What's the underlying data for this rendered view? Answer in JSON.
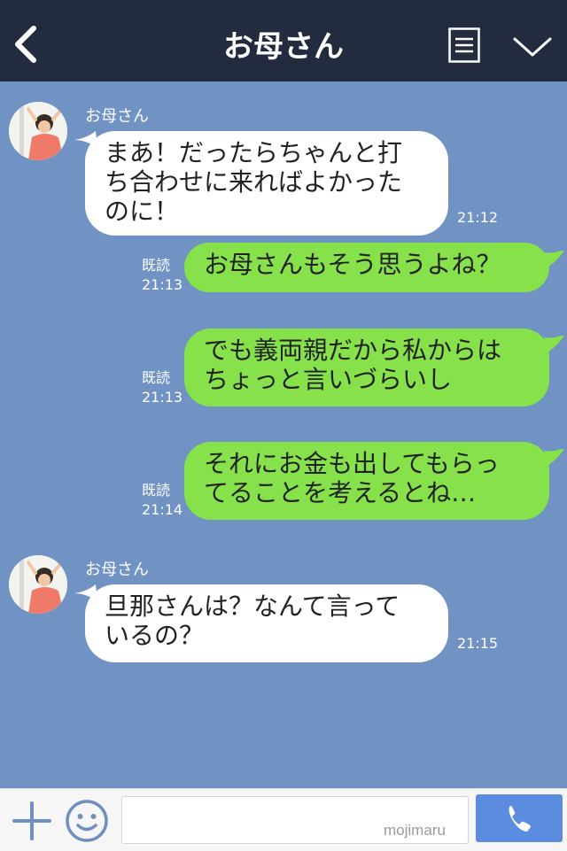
{
  "header": {
    "title": "お母さん",
    "back_icon": "chevron-left-icon",
    "menu_icon": "list-icon",
    "collapse_icon": "chevron-down-icon"
  },
  "messages": [
    {
      "direction": "incoming",
      "sender": "お母さん",
      "lines": [
        "まあ！だったらちゃんと打",
        "ち合わせに来ればよかった",
        "のに！"
      ],
      "time": "21:12"
    },
    {
      "direction": "outgoing",
      "read": "既読",
      "lines": [
        "お母さんもそう思うよね？"
      ],
      "time": "21:13"
    },
    {
      "direction": "outgoing",
      "read": "既読",
      "lines": [
        "でも義両親だから私からは",
        "ちょっと言いづらいし"
      ],
      "time": "21:13"
    },
    {
      "direction": "outgoing",
      "read": "既読",
      "lines": [
        "それにお金も出してもらっ",
        "てることを考えるとね…"
      ],
      "time": "21:14"
    },
    {
      "direction": "incoming",
      "sender": "お母さん",
      "lines": [
        "旦那さんは？なんて言って",
        "いるの？"
      ],
      "time": "21:15"
    }
  ],
  "footer": {
    "plus_icon": "plus-icon",
    "emoji_icon": "smiley-icon",
    "input_value": "",
    "watermark": "mojimaru",
    "call_icon": "phone-icon"
  },
  "colors": {
    "header_bg": "#232b3f",
    "chat_bg": "#7093c4",
    "incoming_bubble": "#ffffff",
    "outgoing_bubble": "#86e14a",
    "call_button": "#5b8ce0"
  }
}
